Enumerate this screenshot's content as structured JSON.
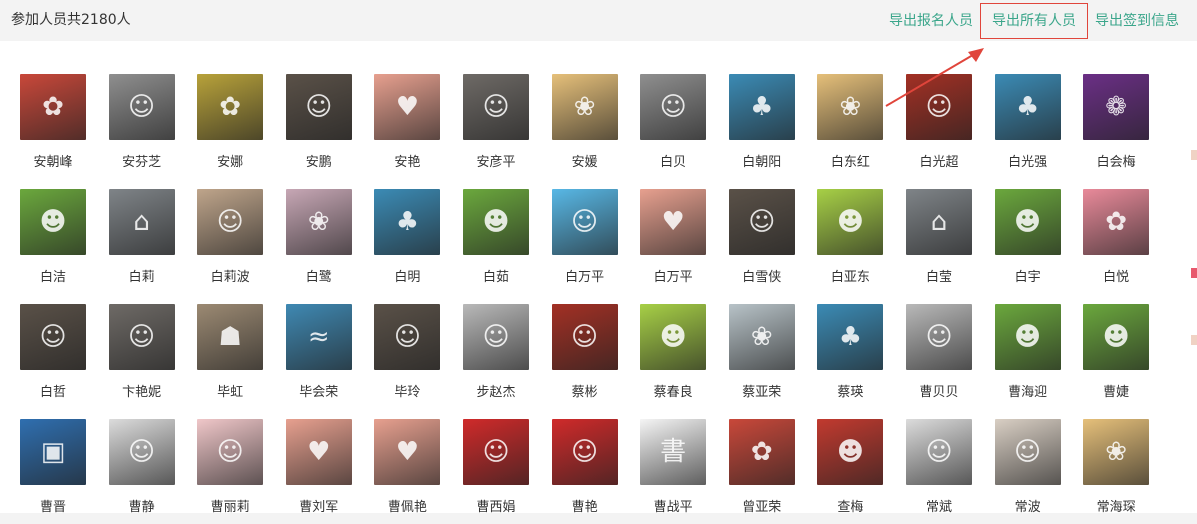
{
  "header": {
    "title": "参加人员共2180人",
    "links": {
      "export_registered": "导出报名人员",
      "export_all": "导出所有人员",
      "export_signin": "导出签到信息"
    }
  },
  "colors": {
    "link": "#3ba68b",
    "highlight": "#e0453b"
  },
  "people": [
    {
      "name": "安朝峰",
      "avatar": "anime-girl-red-hair-icon",
      "bg": "#c9483a",
      "glyph": "✿"
    },
    {
      "name": "安芬芝",
      "avatar": "grey-face-portrait-icon",
      "bg": "#8f8f8f",
      "glyph": "☺"
    },
    {
      "name": "安娜",
      "avatar": "anime-girl-orange-hair-icon",
      "bg": "#b8a23a",
      "glyph": "✿"
    },
    {
      "name": "安鹏",
      "avatar": "dark-hair-girl-icon",
      "bg": "#5a5148",
      "glyph": "☺"
    },
    {
      "name": "安艳",
      "avatar": "anime-couple-icon",
      "bg": "#e7a08f",
      "glyph": "♥"
    },
    {
      "name": "安彦平",
      "avatar": "grey-hair-boy-icon",
      "bg": "#6e6a66",
      "glyph": "☺"
    },
    {
      "name": "安媛",
      "avatar": "flower-crown-girl-icon",
      "bg": "#e6c07a",
      "glyph": "❀"
    },
    {
      "name": "白贝",
      "avatar": "grey-face-portrait-icon",
      "bg": "#8f8f8f",
      "glyph": "☺"
    },
    {
      "name": "白朝阳",
      "avatar": "tree-landscape-icon",
      "bg": "#3b8bb5",
      "glyph": "♣"
    },
    {
      "name": "白东红",
      "avatar": "flower-crown-girl-icon",
      "bg": "#e6c07a",
      "glyph": "❀"
    },
    {
      "name": "白光超",
      "avatar": "man-red-jacket-icon",
      "bg": "#a33024",
      "glyph": "☺"
    },
    {
      "name": "白光强",
      "avatar": "tree-landscape-icon",
      "bg": "#3b8bb5",
      "glyph": "♣"
    },
    {
      "name": "白会梅",
      "avatar": "purple-flowers-icon",
      "bg": "#6b2f86",
      "glyph": "❁"
    },
    {
      "name": "白洁",
      "avatar": "cartoon-cat-icon",
      "bg": "#6ba83d",
      "glyph": "☻"
    },
    {
      "name": "白莉",
      "avatar": "misty-pavilion-icon",
      "bg": "#7f8488",
      "glyph": "⌂"
    },
    {
      "name": "白莉波",
      "avatar": "brown-hair-girl-icon",
      "bg": "#bfa58b",
      "glyph": "☺"
    },
    {
      "name": "白鹭",
      "avatar": "cherry-blossom-icon",
      "bg": "#c7a7b5",
      "glyph": "❀"
    },
    {
      "name": "白明",
      "avatar": "tree-landscape-icon",
      "bg": "#3b8bb5",
      "glyph": "♣"
    },
    {
      "name": "白茹",
      "avatar": "cartoon-cat-icon",
      "bg": "#6ba83d",
      "glyph": "☻"
    },
    {
      "name": "白万平",
      "avatar": "businessman-icon",
      "bg": "#58b8e6",
      "glyph": "☺"
    },
    {
      "name": "白万平",
      "avatar": "anime-couple-icon",
      "bg": "#e7a08f",
      "glyph": "♥"
    },
    {
      "name": "白雪侠",
      "avatar": "dark-hair-girl-icon",
      "bg": "#5a5148",
      "glyph": "☺"
    },
    {
      "name": "白亚东",
      "avatar": "cartoon-bee-icon",
      "bg": "#a7d046",
      "glyph": "☻"
    },
    {
      "name": "白莹",
      "avatar": "misty-pavilion-icon",
      "bg": "#7f8488",
      "glyph": "⌂"
    },
    {
      "name": "白宇",
      "avatar": "cartoon-cat-icon",
      "bg": "#6ba83d",
      "glyph": "☻"
    },
    {
      "name": "白悦",
      "avatar": "pink-flower-icon",
      "bg": "#e98a9a",
      "glyph": "✿"
    },
    {
      "name": "白哲",
      "avatar": "dark-hair-girl-icon",
      "bg": "#5a5148",
      "glyph": "☺"
    },
    {
      "name": "卞艳妮",
      "avatar": "grey-hair-boy-icon",
      "bg": "#6e6a66",
      "glyph": "☺"
    },
    {
      "name": "毕虹",
      "avatar": "street-photo-icon",
      "bg": "#9c8a73",
      "glyph": "☗"
    },
    {
      "name": "毕会荣",
      "avatar": "coast-landscape-icon",
      "bg": "#3f89b3",
      "glyph": "≈"
    },
    {
      "name": "毕玲",
      "avatar": "dark-hair-girl-icon",
      "bg": "#5a5148",
      "glyph": "☺"
    },
    {
      "name": "步赵杰",
      "avatar": "white-hair-boy-icon",
      "bg": "#b9b9b9",
      "glyph": "☺"
    },
    {
      "name": "蔡彬",
      "avatar": "man-red-jacket-icon",
      "bg": "#a33024",
      "glyph": "☺"
    },
    {
      "name": "蔡春良",
      "avatar": "cartoon-bee-icon",
      "bg": "#a7d046",
      "glyph": "☻"
    },
    {
      "name": "蔡亚荣",
      "avatar": "blue-flower-drawing-icon",
      "bg": "#b8c3c8",
      "glyph": "❀"
    },
    {
      "name": "蔡瑛",
      "avatar": "tree-landscape-icon",
      "bg": "#3b8bb5",
      "glyph": "♣"
    },
    {
      "name": "曹贝贝",
      "avatar": "white-hair-boy-icon",
      "bg": "#b9b9b9",
      "glyph": "☺"
    },
    {
      "name": "曹海迎",
      "avatar": "cartoon-cat-icon",
      "bg": "#6ba83d",
      "glyph": "☻"
    },
    {
      "name": "曹婕",
      "avatar": "cartoon-cat-icon",
      "bg": "#6ba83d",
      "glyph": "☻"
    },
    {
      "name": "曹晋",
      "avatar": "blue-device-icon",
      "bg": "#2f6fb0",
      "glyph": "▣"
    },
    {
      "name": "曹静",
      "avatar": "sunglasses-man-icon",
      "bg": "#dcdcdc",
      "glyph": "☺"
    },
    {
      "name": "曹丽莉",
      "avatar": "cartoon-girl-bun-icon",
      "bg": "#f0c7c9",
      "glyph": "☺"
    },
    {
      "name": "曹刘军",
      "avatar": "anime-couple-icon",
      "bg": "#e7a08f",
      "glyph": "♥"
    },
    {
      "name": "曹佩艳",
      "avatar": "anime-couple-icon",
      "bg": "#e7a08f",
      "glyph": "♥"
    },
    {
      "name": "曹西娟",
      "avatar": "id-photo-red-icon",
      "bg": "#d02a2a",
      "glyph": "☺"
    },
    {
      "name": "曹艳",
      "avatar": "id-photo-red-icon",
      "bg": "#d02a2a",
      "glyph": "☺"
    },
    {
      "name": "曹战平",
      "avatar": "calligraphy-text-icon",
      "bg": "#f5f5f5",
      "glyph": "書"
    },
    {
      "name": "曾亚荣",
      "avatar": "anime-girl-red-hair-icon",
      "bg": "#c9483a",
      "glyph": "✿"
    },
    {
      "name": "查梅",
      "avatar": "surprised-cat-icon",
      "bg": "#c23a2f",
      "glyph": "☻"
    },
    {
      "name": "常斌",
      "avatar": "sunglasses-man-icon",
      "bg": "#dcdcdc",
      "glyph": "☺"
    },
    {
      "name": "常波",
      "avatar": "child-photo-icon",
      "bg": "#d9cfc4",
      "glyph": "☺"
    },
    {
      "name": "常海琛",
      "avatar": "flower-crown-girl-icon",
      "bg": "#e6c07a",
      "glyph": "❀"
    }
  ]
}
